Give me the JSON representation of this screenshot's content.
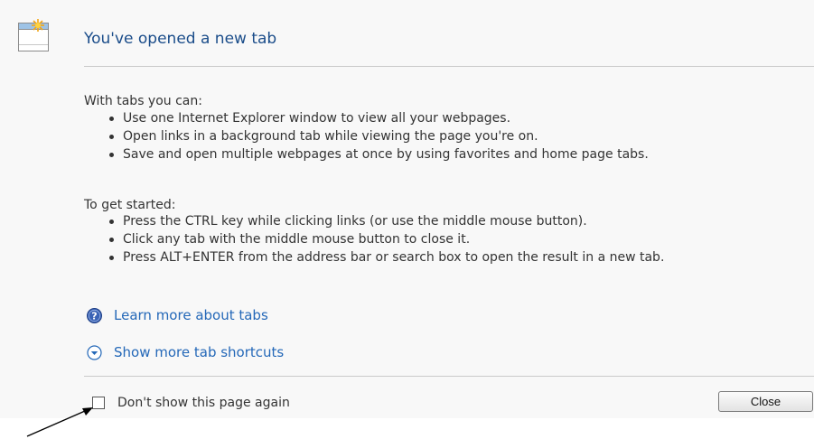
{
  "header": {
    "title": "You've opened a new tab",
    "icon": "new-tab-icon"
  },
  "intro": {
    "heading": "With tabs you can:",
    "items": [
      "Use one Internet Explorer window to view all your webpages.",
      "Open links in a background tab while viewing the page you're on.",
      "Save and open multiple webpages at once by using favorites and home page tabs."
    ]
  },
  "started": {
    "heading": "To get started:",
    "items": [
      "Press the CTRL key while clicking links (or use the middle mouse button).",
      "Click any tab with the middle mouse button to close it.",
      "Press ALT+ENTER from the address bar or search box to open the result in a new tab."
    ]
  },
  "links": {
    "learn_more": "Learn more about tabs",
    "learn_more_icon": "help-icon",
    "show_shortcuts": "Show more tab shortcuts",
    "show_shortcuts_icon": "expand-icon"
  },
  "footer": {
    "dont_show": "Don't show this page again",
    "dont_show_checked": false,
    "close_label": "Close"
  },
  "colors": {
    "title": "#1b4d8a",
    "link": "#2468b8",
    "panel_background": "#f8f8f8"
  }
}
